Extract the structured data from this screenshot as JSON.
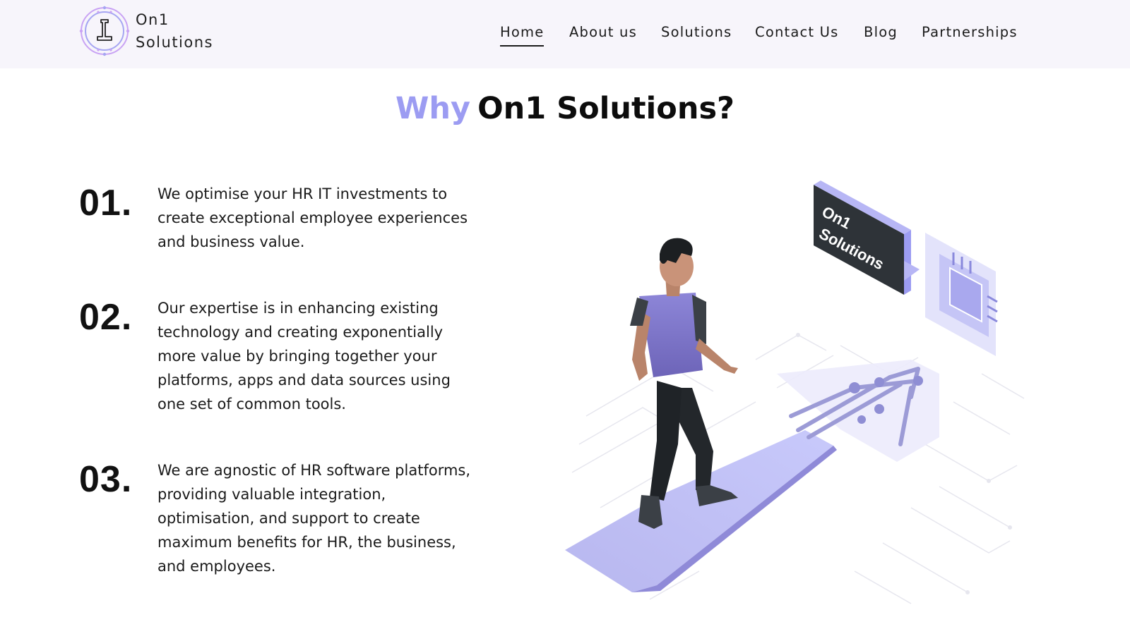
{
  "brand": {
    "line1": "On1",
    "line2": "Solutions",
    "colors": {
      "purple": "#9c9cf2",
      "violet": "#c77dff"
    }
  },
  "nav": {
    "items": [
      {
        "label": "Home",
        "active": true
      },
      {
        "label": "About us"
      },
      {
        "label": "Solutions"
      },
      {
        "label": "Contact Us"
      },
      {
        "label": "Blog"
      },
      {
        "label": "Partnerships"
      }
    ]
  },
  "section": {
    "title_accent": "Why",
    "title_rest": "On1 Solutions?"
  },
  "features": [
    {
      "number": "01.",
      "lines": [
        "We optimise your HR IT investments to",
        "create exceptional employee experiences",
        "and business value."
      ]
    },
    {
      "number": "02.",
      "lines": [
        "Our expertise is in enhancing existing",
        "technology and creating exponentially",
        "more value by bringing together your",
        "platforms, apps and data sources using",
        "one set of common tools."
      ]
    },
    {
      "number": "03.",
      "lines": [
        "We are agnostic of HR software platforms,",
        "providing valuable integration,",
        "optimisation, and support to create",
        "maximum benefits for HR, the business,",
        "and employees."
      ]
    }
  ],
  "illustration": {
    "sign_line1": "On1",
    "sign_line2": "Solutions",
    "icons": [
      "person-walking",
      "circuit-board-arrow",
      "chip-icon",
      "sign-board"
    ]
  }
}
